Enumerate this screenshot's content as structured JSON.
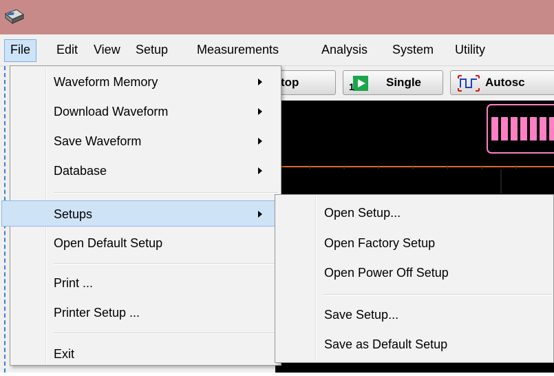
{
  "menubar": {
    "items": [
      "File",
      "Edit",
      "View",
      "Setup",
      "Measurements",
      "Analysis",
      "System",
      "Utility"
    ]
  },
  "toolbar": {
    "stop_label": "top",
    "single_label": "Single",
    "autoscale_label": "Autosc"
  },
  "file_menu": {
    "items": [
      "Waveform Memory",
      "Download Waveform",
      "Save Waveform",
      "Database",
      "Setups",
      "Open Default Setup",
      "Print ...",
      "Printer Setup ...",
      "Exit"
    ]
  },
  "setups_submenu": {
    "items": [
      "Open Setup...",
      "Open Factory Setup",
      "Open Power Off Setup",
      "Save Setup...",
      "Save as Default Setup"
    ]
  },
  "colors": {
    "titlebar": "#c88a88",
    "highlight": "#cfe3f7",
    "trace_orange": "#e06a1e",
    "trace_pink": "#ff7fc4"
  }
}
